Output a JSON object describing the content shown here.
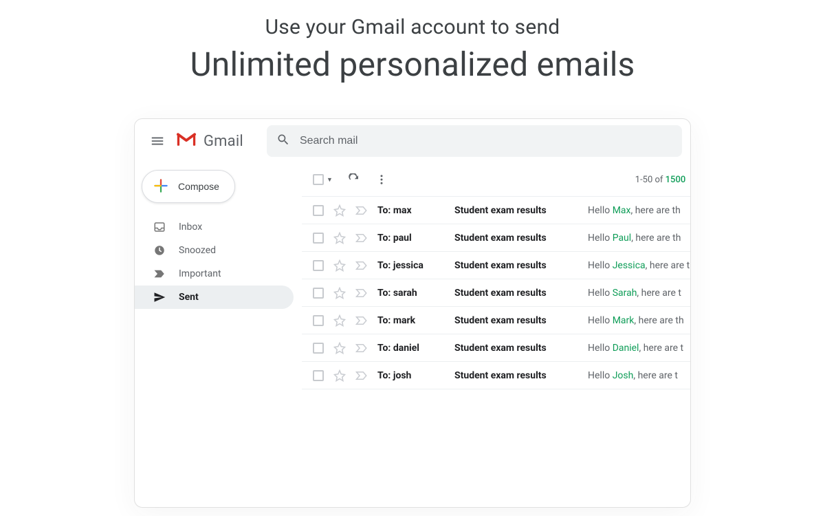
{
  "hero": {
    "line1": "Use your Gmail account to send",
    "line2": "Unlimited personalized emails"
  },
  "app": {
    "name": "Gmail"
  },
  "search": {
    "placeholder": "Search mail"
  },
  "compose": {
    "label": "Compose"
  },
  "nav": {
    "inbox": "Inbox",
    "snoozed": "Snoozed",
    "important": "Important",
    "sent": "Sent"
  },
  "toolbar": {
    "range": "1-50 of ",
    "total": "1500"
  },
  "rows": [
    {
      "to": "To: max",
      "subject": "Student exam results",
      "pre": "Hello ",
      "name": "Max",
      "post": ", here are th"
    },
    {
      "to": "To: paul",
      "subject": "Student exam results",
      "pre": "Hello ",
      "name": "Paul",
      "post": ", here are th"
    },
    {
      "to": "To: jessica",
      "subject": "Student exam results",
      "pre": "Hello ",
      "name": "Jessica",
      "post": ", here are t"
    },
    {
      "to": "To: sarah",
      "subject": "Student exam results",
      "pre": "Hello ",
      "name": "Sarah",
      "post": ", here are t"
    },
    {
      "to": "To: mark",
      "subject": "Student exam results",
      "pre": "Hello ",
      "name": "Mark",
      "post": ", here are th"
    },
    {
      "to": "To: daniel",
      "subject": "Student exam results",
      "pre": "Hello ",
      "name": "Daniel",
      "post": ", here are t"
    },
    {
      "to": "To: josh",
      "subject": "Student exam results",
      "pre": "Hello ",
      "name": "Josh",
      "post": ", here are t"
    }
  ],
  "colors": {
    "accent": "#0f9d58",
    "mutedText": "#5f6368"
  }
}
